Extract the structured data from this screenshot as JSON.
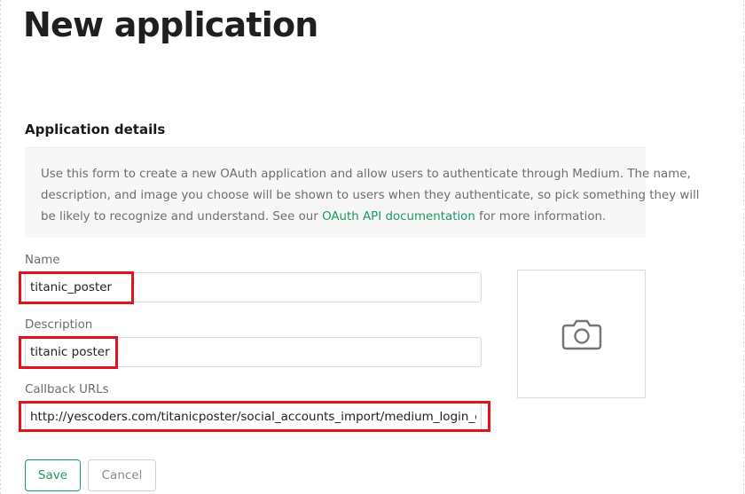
{
  "page": {
    "title": "New application"
  },
  "section": {
    "title": "Application details"
  },
  "info": {
    "line1": "Use this form to create a new OAuth application and allow users to authenticate through Medium. The name,",
    "line2": "description, and image you choose will be shown to users when they authenticate, so pick something they will",
    "line3_prefix": "be likely to recognize and understand. See our ",
    "link_text": "OAuth API documentation",
    "line3_suffix": " for more information."
  },
  "form": {
    "name": {
      "label": "Name",
      "value": "titanic_poster"
    },
    "description": {
      "label": "Description",
      "value": "titanic poster"
    },
    "callback": {
      "label": "Callback URLs",
      "value": "http://yescoders.com/titanicposter/social_accounts_import/medium_login_callback"
    }
  },
  "image_upload": {
    "icon": "camera-icon"
  },
  "buttons": {
    "save_label": "Save",
    "cancel_label": "Cancel"
  },
  "colors": {
    "accent": "#1c9963",
    "highlight": "#e2111d",
    "info_bg": "#f7f7f7"
  }
}
